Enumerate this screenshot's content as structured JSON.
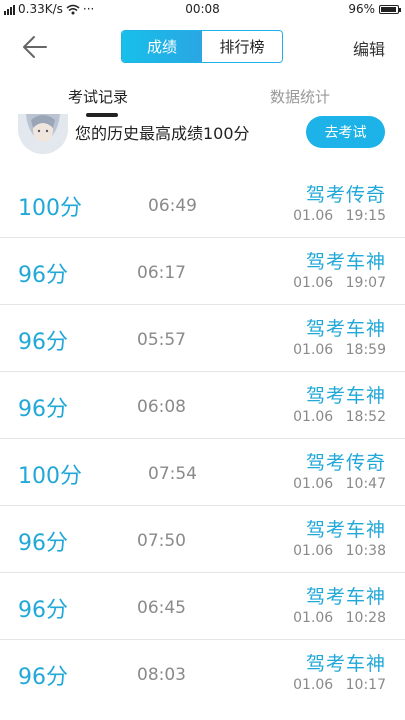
{
  "status_bar": {
    "network_speed": "0.33K/s",
    "more": "···",
    "time": "00:08",
    "battery": "96%",
    "battery_level": 0.96
  },
  "nav": {
    "segments": [
      "成绩",
      "排行榜"
    ],
    "active_segment": 0,
    "edit_label": "编辑"
  },
  "tabs": {
    "records_label": "考试记录",
    "stats_label": "数据统计"
  },
  "best": {
    "text": "您的历史最高成绩100分",
    "button_label": "去考试"
  },
  "records": [
    {
      "score": "100分",
      "duration": "06:49",
      "title": "驾考传奇",
      "date": "01.06 19:15"
    },
    {
      "score": "96分",
      "duration": "06:17",
      "title": "驾考车神",
      "date": "01.06 19:07"
    },
    {
      "score": "96分",
      "duration": "05:57",
      "title": "驾考车神",
      "date": "01.06 18:59"
    },
    {
      "score": "96分",
      "duration": "06:08",
      "title": "驾考车神",
      "date": "01.06 18:52"
    },
    {
      "score": "100分",
      "duration": "07:54",
      "title": "驾考传奇",
      "date": "01.06 10:47"
    },
    {
      "score": "96分",
      "duration": "07:50",
      "title": "驾考车神",
      "date": "01.06 10:38"
    },
    {
      "score": "96分",
      "duration": "06:45",
      "title": "驾考车神",
      "date": "01.06 10:28"
    },
    {
      "score": "96分",
      "duration": "08:03",
      "title": "驾考车神",
      "date": "01.06 10:17"
    }
  ],
  "colors": {
    "accent": "#1db3e8",
    "score": "#22a8d8",
    "muted": "#8a8a8a"
  }
}
